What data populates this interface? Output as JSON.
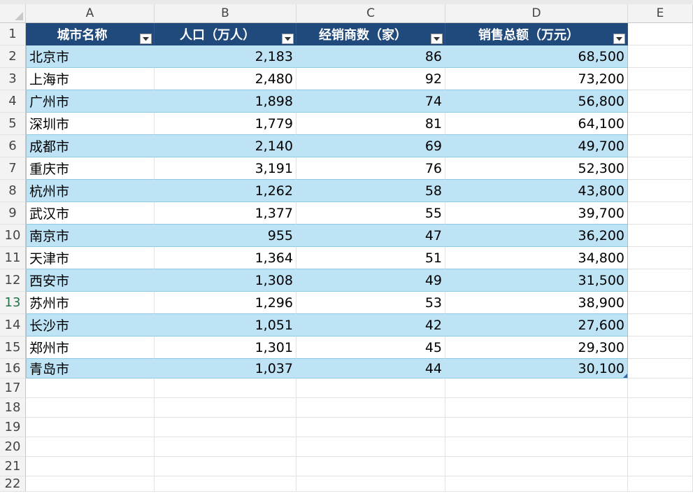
{
  "columns": [
    "A",
    "B",
    "C",
    "D",
    "E"
  ],
  "table": {
    "headers": [
      "城市名称",
      "人口（万人）",
      "经销商数（家）",
      "销售总额（万元）"
    ],
    "rows": [
      [
        "北京市",
        "2,183",
        "86",
        "68,500"
      ],
      [
        "上海市",
        "2,480",
        "92",
        "73,200"
      ],
      [
        "广州市",
        "1,898",
        "74",
        "56,800"
      ],
      [
        "深圳市",
        "1,779",
        "81",
        "64,100"
      ],
      [
        "成都市",
        "2,140",
        "69",
        "49,700"
      ],
      [
        "重庆市",
        "3,191",
        "76",
        "52,300"
      ],
      [
        "杭州市",
        "1,262",
        "58",
        "43,800"
      ],
      [
        "武汉市",
        "1,377",
        "55",
        "39,700"
      ],
      [
        "南京市",
        "955",
        "47",
        "36,200"
      ],
      [
        "天津市",
        "1,364",
        "51",
        "34,800"
      ],
      [
        "西安市",
        "1,308",
        "49",
        "31,500"
      ],
      [
        "苏州市",
        "1,296",
        "53",
        "38,900"
      ],
      [
        "长沙市",
        "1,051",
        "42",
        "27,600"
      ],
      [
        "郑州市",
        "1,301",
        "45",
        "29,300"
      ],
      [
        "青岛市",
        "1,037",
        "44",
        "30,100"
      ]
    ]
  },
  "row_numbers": [
    "1",
    "2",
    "3",
    "4",
    "5",
    "6",
    "7",
    "8",
    "9",
    "10",
    "11",
    "12",
    "13",
    "14",
    "15",
    "16",
    "17",
    "18",
    "19",
    "20",
    "21",
    "22"
  ],
  "active_row": "13",
  "colors": {
    "header_fill": "#214a7c",
    "band_fill": "#bde3f5",
    "active_accent": "#217346"
  }
}
